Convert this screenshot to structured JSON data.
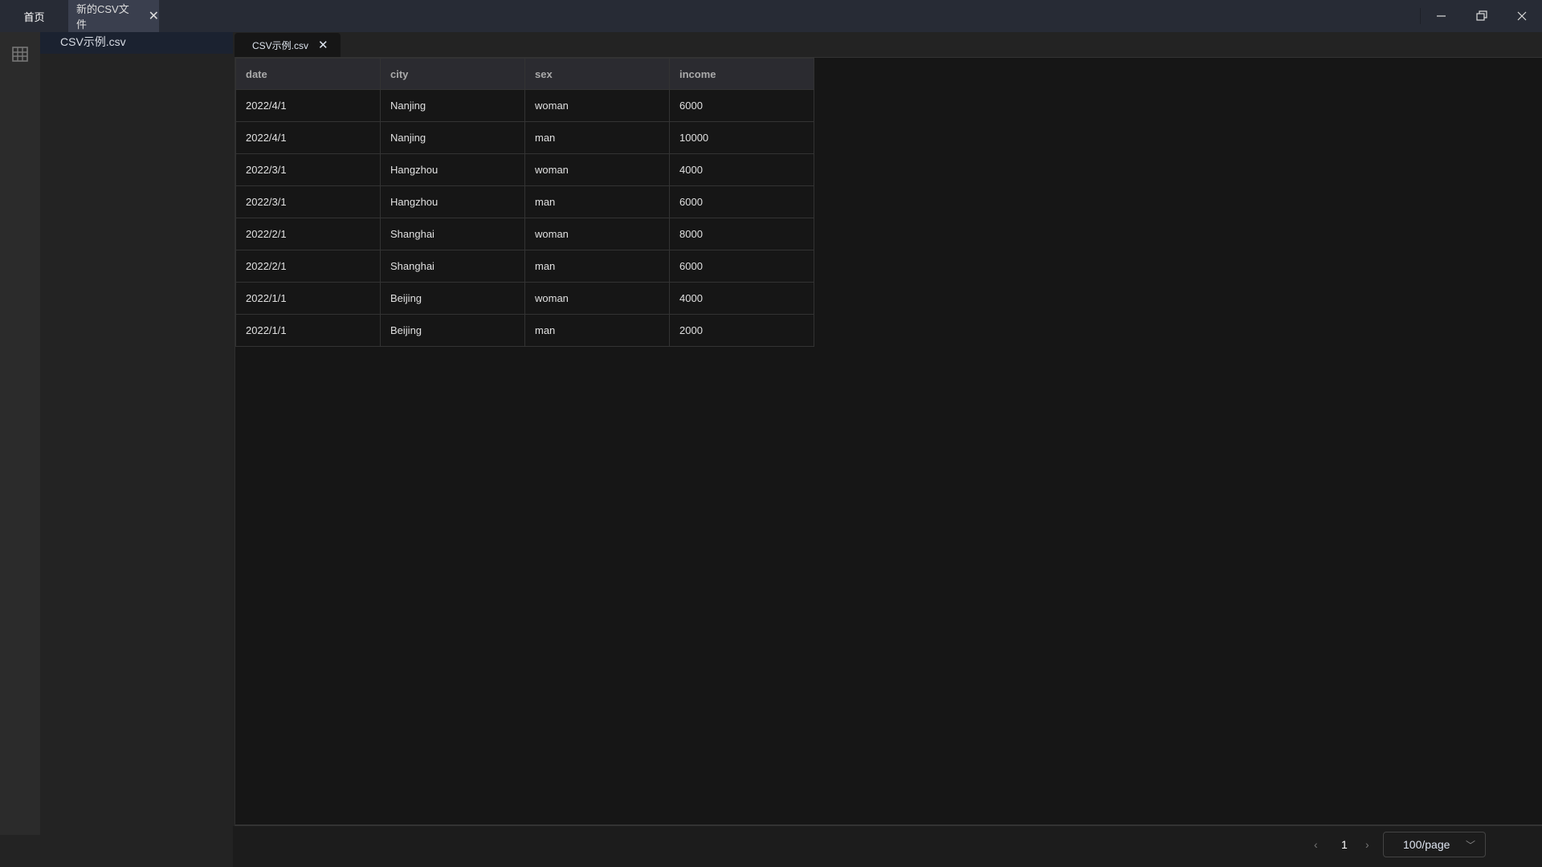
{
  "titlebar": {
    "tabs": [
      {
        "label": "首页"
      },
      {
        "label": "新的CSV文件"
      }
    ],
    "close_glyph": "✕"
  },
  "sidebar": {
    "files": [
      {
        "label": "CSV示例.csv"
      }
    ]
  },
  "editor": {
    "tab": {
      "label": "CSV示例.csv"
    }
  },
  "table": {
    "columns": [
      "date",
      "city",
      "sex",
      "income"
    ],
    "rows": [
      [
        "2022/4/1",
        "Nanjing",
        "woman",
        "6000"
      ],
      [
        "2022/4/1",
        "Nanjing",
        "man",
        "10000"
      ],
      [
        "2022/3/1",
        "Hangzhou",
        "woman",
        "4000"
      ],
      [
        "2022/3/1",
        "Hangzhou",
        "man",
        "6000"
      ],
      [
        "2022/2/1",
        "Shanghai",
        "woman",
        "8000"
      ],
      [
        "2022/2/1",
        "Shanghai",
        "man",
        "6000"
      ],
      [
        "2022/1/1",
        "Beijing",
        "woman",
        "4000"
      ],
      [
        "2022/1/1",
        "Beijing",
        "man",
        "2000"
      ]
    ]
  },
  "pagination": {
    "current_page": "1",
    "page_size": "100/page"
  }
}
